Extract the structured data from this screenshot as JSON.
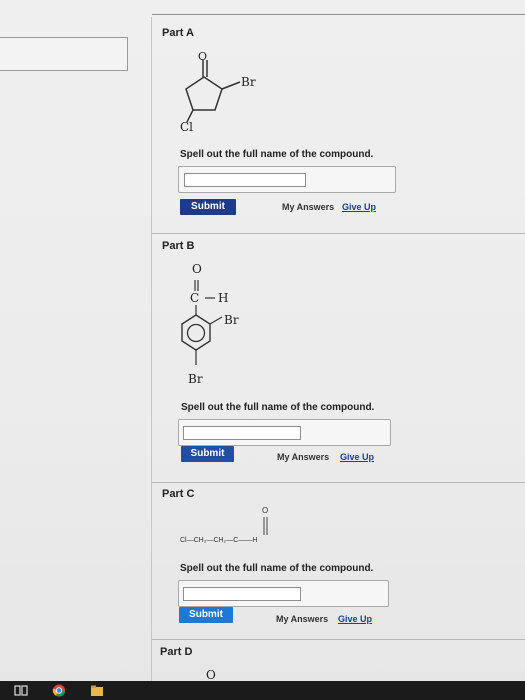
{
  "parts": [
    {
      "label": "Part A",
      "prompt": "Spell out the full name of the compound.",
      "submit_label": "Submit",
      "my_answers_label": "My Answers",
      "give_up_label": "Give Up",
      "structure_labels": {
        "o": "O",
        "br": "Br",
        "cl": "Cl"
      }
    },
    {
      "label": "Part B",
      "prompt": "Spell out the full name of the compound.",
      "submit_label": "Submit",
      "my_answers_label": "My Answers",
      "give_up_label": "Give Up",
      "structure_labels": {
        "o": "O",
        "ch": "C",
        "h": "H",
        "br1": "Br",
        "br2": "Br"
      }
    },
    {
      "label": "Part C",
      "prompt": "Spell out the full name of the compound.",
      "submit_label": "Submit",
      "my_answers_label": "My Answers",
      "give_up_label": "Give Up",
      "structure_labels": {
        "o": "O",
        "formula": "Cl—CH₂—CH₂—C——H"
      }
    },
    {
      "label": "Part D",
      "structure_labels": {
        "o": "O"
      }
    }
  ],
  "colors": {
    "submit": "#1e3a8a",
    "submit_c": "#1f78d1",
    "link": "#1a3f9b"
  },
  "taskbar": {
    "icons": [
      "windows-task-view-icon",
      "chrome-icon",
      "file-explorer-icon"
    ]
  }
}
